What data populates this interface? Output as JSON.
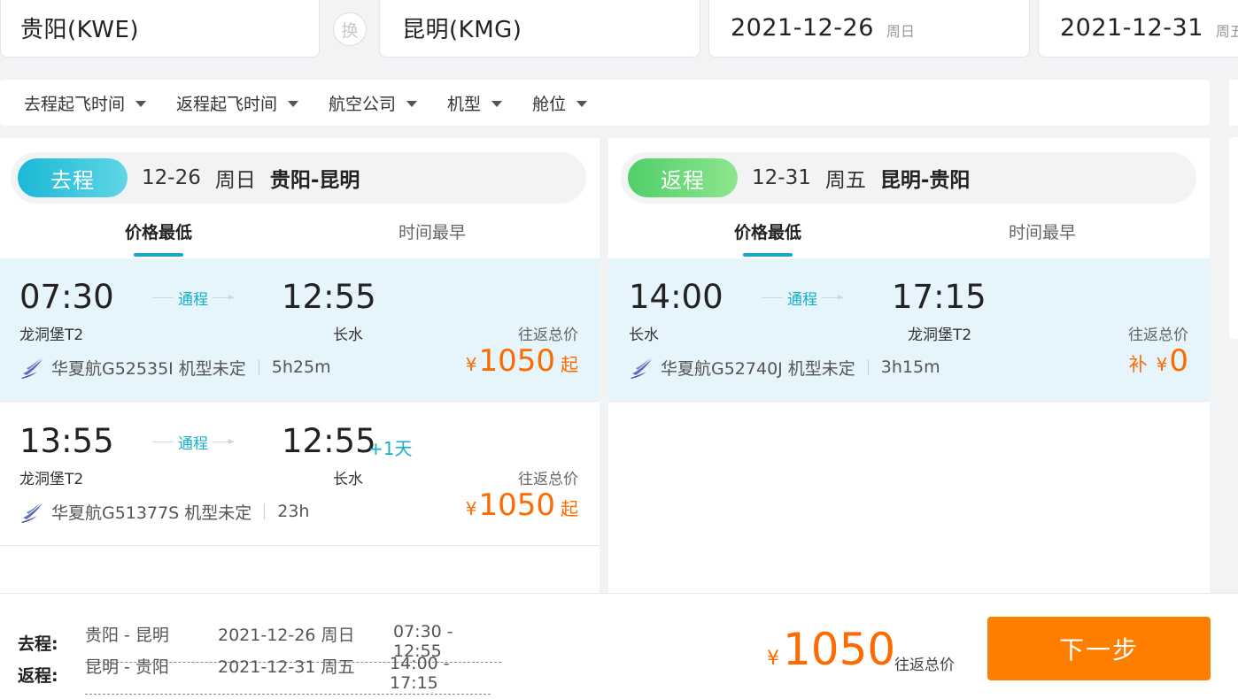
{
  "search": {
    "from_city": "贵阳(KWE)",
    "swap_label": "换",
    "to_city": "昆明(KMG)",
    "depart_date": "2021-12-26",
    "depart_weekday": "周日",
    "return_date": "2021-12-31",
    "return_weekday": "周五"
  },
  "filters": [
    {
      "label": "去程起飞时间"
    },
    {
      "label": "返程起飞时间"
    },
    {
      "label": "航空公司"
    },
    {
      "label": "机型"
    },
    {
      "label": "舱位"
    }
  ],
  "outbound": {
    "badge": "去程",
    "date": "12-26",
    "weekday": "周日",
    "route": "贵阳-昆明",
    "tabs": [
      "价格最低",
      "时间最早"
    ],
    "flights": [
      {
        "dep_time": "07:30",
        "arr_time": "12:55",
        "stop_label": "通程",
        "plus_day": "",
        "dep_airport": "龙洞堡T2",
        "arr_airport": "长水",
        "airline": "华夏航G52535I",
        "aircraft": "机型未定",
        "duration": "5h25m",
        "price_label": "往返总价",
        "currency": "¥",
        "price": "1050",
        "price_suffix": "起"
      },
      {
        "dep_time": "13:55",
        "arr_time": "12:55",
        "stop_label": "通程",
        "plus_day": "+1天",
        "dep_airport": "龙洞堡T2",
        "arr_airport": "长水",
        "airline": "华夏航G51377S",
        "aircraft": "机型未定",
        "duration": "23h",
        "price_label": "往返总价",
        "currency": "¥",
        "price": "1050",
        "price_suffix": "起"
      }
    ]
  },
  "inbound": {
    "badge": "返程",
    "date": "12-31",
    "weekday": "周五",
    "route": "昆明-贵阳",
    "tabs": [
      "价格最低",
      "时间最早"
    ],
    "flights": [
      {
        "dep_time": "14:00",
        "arr_time": "17:15",
        "stop_label": "通程",
        "dep_airport": "长水",
        "arr_airport": "龙洞堡T2",
        "airline": "华夏航G52740J",
        "aircraft": "机型未定",
        "duration": "3h15m",
        "price_label": "往返总价",
        "price_prefix": "补",
        "currency": "¥",
        "price": "0"
      }
    ]
  },
  "summary": {
    "outbound": {
      "label": "去程:",
      "route": "贵阳 - 昆明",
      "date": "2021-12-26 周日",
      "time": "07:30 - 12:55"
    },
    "inbound": {
      "label": "返程:",
      "route": "昆明 - 贵阳",
      "date": "2021-12-31 周五",
      "time": "14:00 - 17:15"
    },
    "currency": "¥",
    "total": "1050",
    "total_label": "往返总价",
    "next_label": "下一步"
  },
  "colors": {
    "accent": "#1aa7c8",
    "price": "#ff6a00",
    "button": "#ff7e00",
    "selected_row": "#e6f4fb"
  },
  "icons": [
    "swap-icon",
    "caret-down-icon",
    "airline-logo-icon"
  ]
}
